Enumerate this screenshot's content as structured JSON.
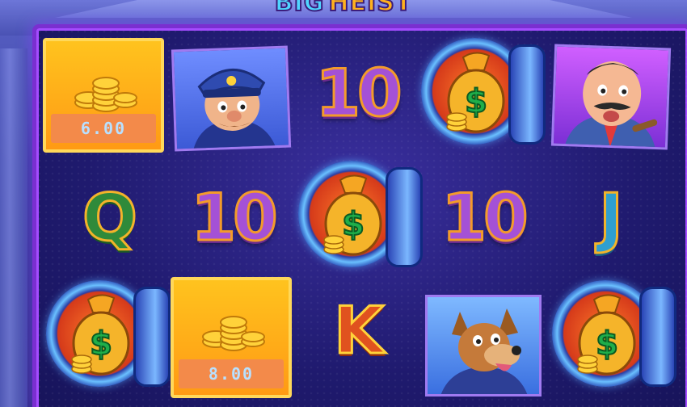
{
  "game": {
    "logo_part1": "BIG",
    "logo_part2": "HEIST"
  },
  "reels": {
    "cash_values": [
      "6.00",
      "8.00"
    ],
    "symbols": {
      "r1c3": "10",
      "r2c1": "Q",
      "r2c2": "10",
      "r2c4": "10",
      "r2c5": "J",
      "r3c3": "K"
    }
  },
  "icons": {
    "policeman": "policeman-character-icon",
    "boss": "mustached-boss-character-icon",
    "dog": "guard-dog-character-icon",
    "vault": "money-bag-vault-icon",
    "coins": "gold-coins-icon"
  },
  "colors": {
    "frame": "#7a2fd0",
    "cash_tile": "#ffb21e",
    "ten": "#a451d6",
    "q": "#2f8a3a",
    "j": "#2f9fd0",
    "k": "#e0521f"
  }
}
